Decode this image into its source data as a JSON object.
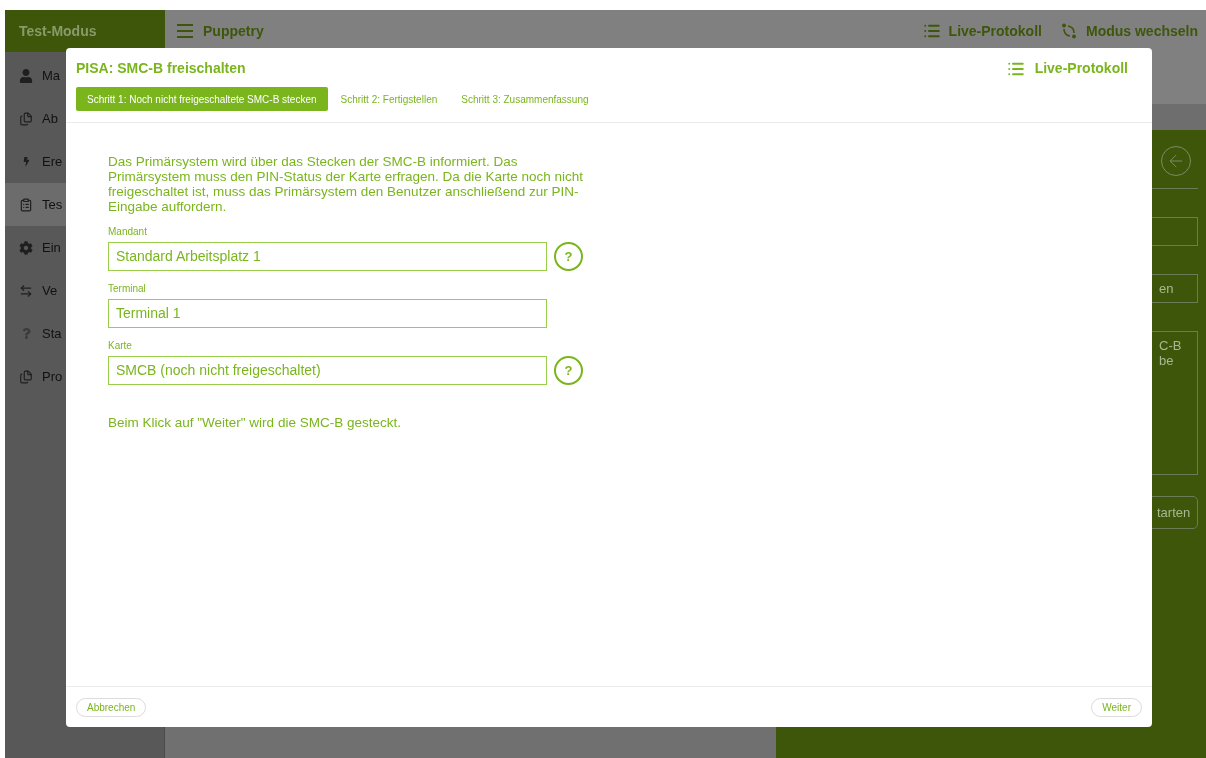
{
  "app": {
    "mode_title": "Test-Modus",
    "app_name": "Puppetry",
    "header_actions": [
      {
        "kind": "log",
        "label": "Live-Protokoll"
      },
      {
        "kind": "switch",
        "label": "Modus wechseln"
      }
    ]
  },
  "sidebar": {
    "items": [
      {
        "kind": "person",
        "label": "Ma",
        "selected": false
      },
      {
        "kind": "documents",
        "label": "Ab",
        "selected": false
      },
      {
        "kind": "bolt",
        "label": "Ere",
        "selected": false
      },
      {
        "kind": "clipboard",
        "label": "Tes",
        "selected": true
      },
      {
        "kind": "gear",
        "label": "Ein",
        "selected": false
      },
      {
        "kind": "arrows",
        "label": "Ve",
        "selected": false
      },
      {
        "kind": "question",
        "label": "Sta",
        "selected": false
      },
      {
        "kind": "documents",
        "label": "Pro",
        "selected": false
      }
    ]
  },
  "right_panel": {
    "fields": [
      {
        "kind": "input"
      },
      {
        "kind": "input",
        "value": "en"
      },
      {
        "kind": "textarea",
        "lines": [
          "C-B",
          "be"
        ]
      }
    ],
    "button": "tarten"
  },
  "dialog": {
    "title": "PISA: SMC-B freischalten",
    "live_log_label": "Live-Protokoll",
    "steps": [
      {
        "label": "Schritt 1: Noch nicht freigeschaltete SMC-B stecken",
        "selected": true
      },
      {
        "label": "Schritt 2: Fertigstellen",
        "selected": false
      },
      {
        "label": "Schritt 3: Zusammenfassung",
        "selected": false
      }
    ],
    "description": "Das Primärsystem wird über das Stecken der SMC-B informiert. Das Primärsystem muss den PIN-Status der Karte erfragen. Da die Karte noch nicht freigeschaltet ist, muss das Primärsystem den Benutzer anschließend zur PIN-Eingabe auffordern.",
    "fields": [
      {
        "label": "Mandant",
        "value": "Standard Arbeitsplatz 1",
        "help": "?"
      },
      {
        "label": "Terminal",
        "value": "Terminal 1"
      },
      {
        "label": "Karte",
        "value": "SMCB (noch nicht freigeschaltet)",
        "help": "?"
      }
    ],
    "note": "Beim Klick auf \"Weiter\" wird die SMC-B gesteckt.",
    "cancel_label": "Abbrechen",
    "next_label": "Weiter"
  }
}
